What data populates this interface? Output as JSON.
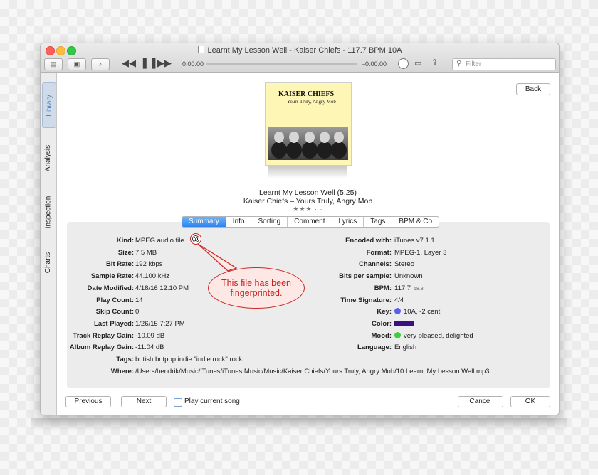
{
  "window": {
    "title": "Learnt My Lesson Well - Kaiser Chiefs - 117.7 BPM 10A"
  },
  "toolbar": {
    "time_elapsed": "0:00.00",
    "time_remaining": "–0:00.00",
    "filter_placeholder": "Filter",
    "progress": 0
  },
  "sidebar": {
    "tabs": [
      "Library",
      "Analysis",
      "Inspection",
      "Charts"
    ],
    "active": "Library"
  },
  "header": {
    "back_label": "Back"
  },
  "album_art": {
    "band": "KAISER CHIEFS",
    "album": "Yours Truly, Angry Mob"
  },
  "track": {
    "title_line": "Learnt My Lesson Well (5:25)",
    "artist_line": "Kaiser Chiefs – Yours Truly, Angry Mob",
    "rating": "★★★ · ·"
  },
  "tabs": {
    "items": [
      "Summary",
      "Info",
      "Sorting",
      "Comment",
      "Lyrics",
      "Tags",
      "BPM & Co"
    ],
    "active": "Summary"
  },
  "details_left": [
    {
      "label": "Kind:",
      "value": "MPEG audio file"
    },
    {
      "label": "Size:",
      "value": "7.5 MB"
    },
    {
      "label": "Bit Rate:",
      "value": "192 kbps"
    },
    {
      "label": "Sample Rate:",
      "value": "44.100 kHz"
    },
    {
      "label": "Date Modified:",
      "value": "4/18/16 12:10 PM"
    },
    {
      "label": "Play Count:",
      "value": "14"
    },
    {
      "label": "Skip Count:",
      "value": "0"
    },
    {
      "label": "Last Played:",
      "value": "1/26/15 7:27 PM"
    },
    {
      "label": "Track Replay Gain:",
      "value": "-10.09 dB"
    },
    {
      "label": "Album Replay Gain:",
      "value": "-11.04 dB"
    }
  ],
  "details_right": [
    {
      "label": "Encoded with:",
      "value": "iTunes v7.1.1"
    },
    {
      "label": "Format:",
      "value": "MPEG-1, Layer 3"
    },
    {
      "label": "Channels:",
      "value": "Stereo"
    },
    {
      "label": "Bits per sample:",
      "value": "Unknown"
    },
    {
      "label": "BPM:",
      "value": "117.7",
      "extra": "58.8"
    },
    {
      "label": "Time Signature:",
      "value": "4/4"
    },
    {
      "label": "Key:",
      "value": "10A, -2 cent",
      "dot_color": "#5a5ef0"
    },
    {
      "label": "Color:",
      "value": "",
      "swatch_color": "#3a1180"
    },
    {
      "label": "Mood:",
      "value": "very pleased, delighted",
      "dot_color": "#3cd13c"
    },
    {
      "label": "Language:",
      "value": "English"
    }
  ],
  "details_full": [
    {
      "label": "Tags:",
      "value": "british britpop indie \"indie rock\" rock"
    },
    {
      "label": "Where:",
      "value": "/Users/hendrik/Music/iTunes/iTunes Music/Music/Kaiser Chiefs/Yours Truly, Angry Mob/10 Learnt My Lesson Well.mp3"
    }
  ],
  "annotation": {
    "line1": "This file has been",
    "line2": "fingerprinted."
  },
  "footer": {
    "previous_label": "Previous",
    "next_label": "Next",
    "play_current_label": "Play current song",
    "cancel_label": "Cancel",
    "ok_label": "OK"
  }
}
